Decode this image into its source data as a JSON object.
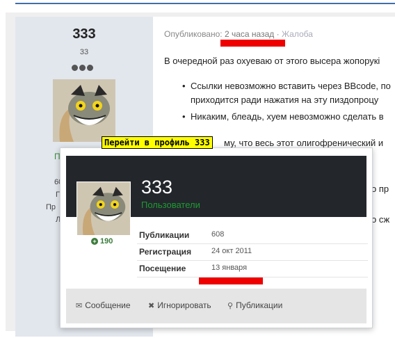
{
  "author": {
    "name": "333",
    "title": "33",
    "side_peek": [
      "П",
      "60",
      "Г",
      "Пр",
      "Л"
    ]
  },
  "post": {
    "published_label": "Опубликовано:",
    "time": "2 часа назад",
    "separator": "·",
    "report": "Жалоба",
    "lines": [
      "В очередной раз охуеваю от этого высера жопорукі",
      "Ссылки невозможно вставить через BBcode, по",
      "приходится ради нажатия на эту пиздопроцу",
      "Никаким, блеадь, хуем невозможно сделать в",
      "му, что весь этот олигофренический и",
      "о пр",
      "о сж"
    ]
  },
  "tooltip": "Перейти в профиль 333",
  "card": {
    "name": "333",
    "group": "Пользователи",
    "reputation": "190",
    "reputation_icon": "plus-circle-icon",
    "stats": [
      {
        "label": "Публикации",
        "value": "608"
      },
      {
        "label": "Регистрация",
        "value": "24 окт 2011"
      },
      {
        "label": "Посещение",
        "value": "13 января"
      }
    ],
    "actions": [
      {
        "icon": "envelope-icon",
        "label": "Сообщение"
      },
      {
        "icon": "block-icon",
        "label": "Игнорировать"
      },
      {
        "icon": "search-icon",
        "label": "Публикации"
      }
    ]
  },
  "colors": {
    "annotation_red": "#ee0000",
    "group_green": "#1f9a32",
    "header_dark": "#23272c",
    "tooltip_yellow": "#ffff00"
  }
}
